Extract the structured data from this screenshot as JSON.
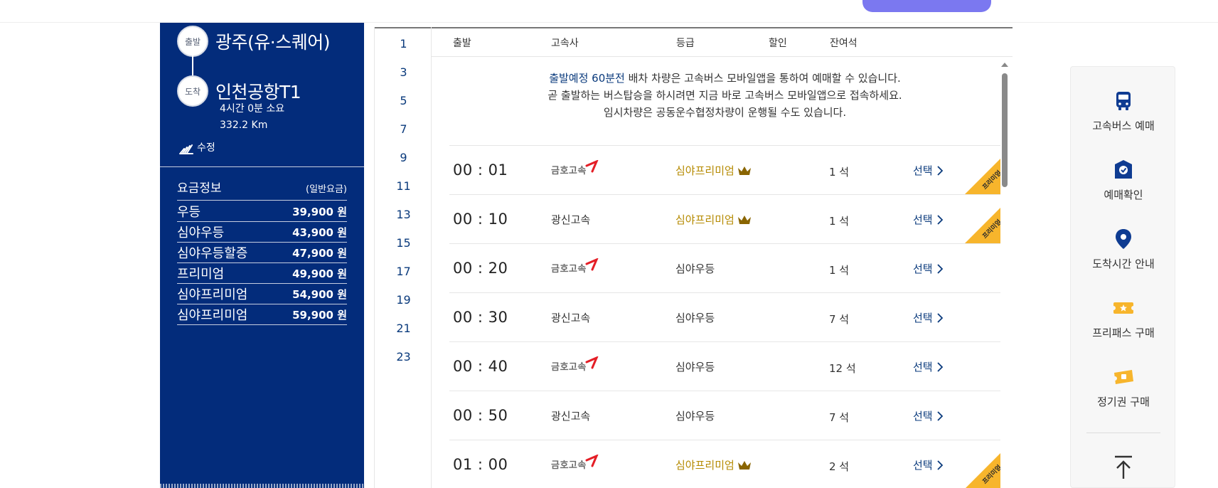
{
  "colors": {
    "navy": "#032c7b",
    "premium_gold": "#b58a00",
    "ribbon": "#f7b52c",
    "accent_pill": "#7b78f0"
  },
  "route": {
    "departure_badge": "출발",
    "departure": "광주(유·스퀘어)",
    "arrival_badge": "도착",
    "arrival": "인천공항T1",
    "duration": "4시간 0분 소요",
    "distance": "332.2 Km",
    "edit_label": "수정"
  },
  "fare": {
    "title": "요금정보",
    "subtitle": "(일반요금)",
    "items": [
      {
        "name": "우등",
        "price": "39,900 원"
      },
      {
        "name": "심야우등",
        "price": "43,900 원"
      },
      {
        "name": "심야우등할증",
        "price": "47,900 원"
      },
      {
        "name": "프리미엄",
        "price": "49,900 원"
      },
      {
        "name": "심야프리미엄",
        "price": "54,900 원"
      },
      {
        "name": "심야프리미엄",
        "price": "59,900 원"
      }
    ]
  },
  "hours": [
    "1",
    "3",
    "5",
    "7",
    "9",
    "11",
    "13",
    "15",
    "17",
    "19",
    "21",
    "23"
  ],
  "table": {
    "headers": {
      "departure": "출발",
      "company": "고속사",
      "grade": "등급",
      "discount": "할인",
      "seats": "잔여석"
    },
    "notice": {
      "line1_highlight": "출발예정 60분전",
      "line1_rest": " 배차 차량은 고속버스 모바일앱을 통하여 예매할 수 있습니다.",
      "line2": "곧 출발하는 버스탑승을 하시려면 지금 바로 고속버스 모바일앱으로 접속하세요.",
      "line3": "임시차량은 공동운수협정차량이 운행될 수도 있습니다."
    },
    "select_label": "선택",
    "ribbon_label": "프리미엄",
    "rows": [
      {
        "time": "00 : 01",
        "company": "금호고속",
        "company_logo": true,
        "grade": "심야프리미엄",
        "premium": true,
        "seats": "1 석",
        "ribbon": true
      },
      {
        "time": "00 : 10",
        "company": "광신고속",
        "company_logo": false,
        "grade": "심야프리미엄",
        "premium": true,
        "seats": "1 석",
        "ribbon": true
      },
      {
        "time": "00 : 20",
        "company": "금호고속",
        "company_logo": true,
        "grade": "심야우등",
        "premium": false,
        "seats": "1 석",
        "ribbon": false
      },
      {
        "time": "00 : 30",
        "company": "광신고속",
        "company_logo": false,
        "grade": "심야우등",
        "premium": false,
        "seats": "7 석",
        "ribbon": false
      },
      {
        "time": "00 : 40",
        "company": "금호고속",
        "company_logo": true,
        "grade": "심야우등",
        "premium": false,
        "seats": "12 석",
        "ribbon": false
      },
      {
        "time": "00 : 50",
        "company": "광신고속",
        "company_logo": false,
        "grade": "심야우등",
        "premium": false,
        "seats": "7 석",
        "ribbon": false
      },
      {
        "time": "01 : 00",
        "company": "금호고속",
        "company_logo": true,
        "grade": "심야프리미엄",
        "premium": true,
        "seats": "2 석",
        "ribbon": true
      }
    ]
  },
  "quick_menu": [
    {
      "icon": "bus-icon",
      "label": "고속버스 예매"
    },
    {
      "icon": "ticket-check-icon",
      "label": "예매확인"
    },
    {
      "icon": "location-pin-icon",
      "label": "도착시간 안내"
    },
    {
      "icon": "free-pass-icon",
      "label": "프리패스 구매"
    },
    {
      "icon": "commuter-pass-icon",
      "label": "정기권 구매"
    }
  ]
}
